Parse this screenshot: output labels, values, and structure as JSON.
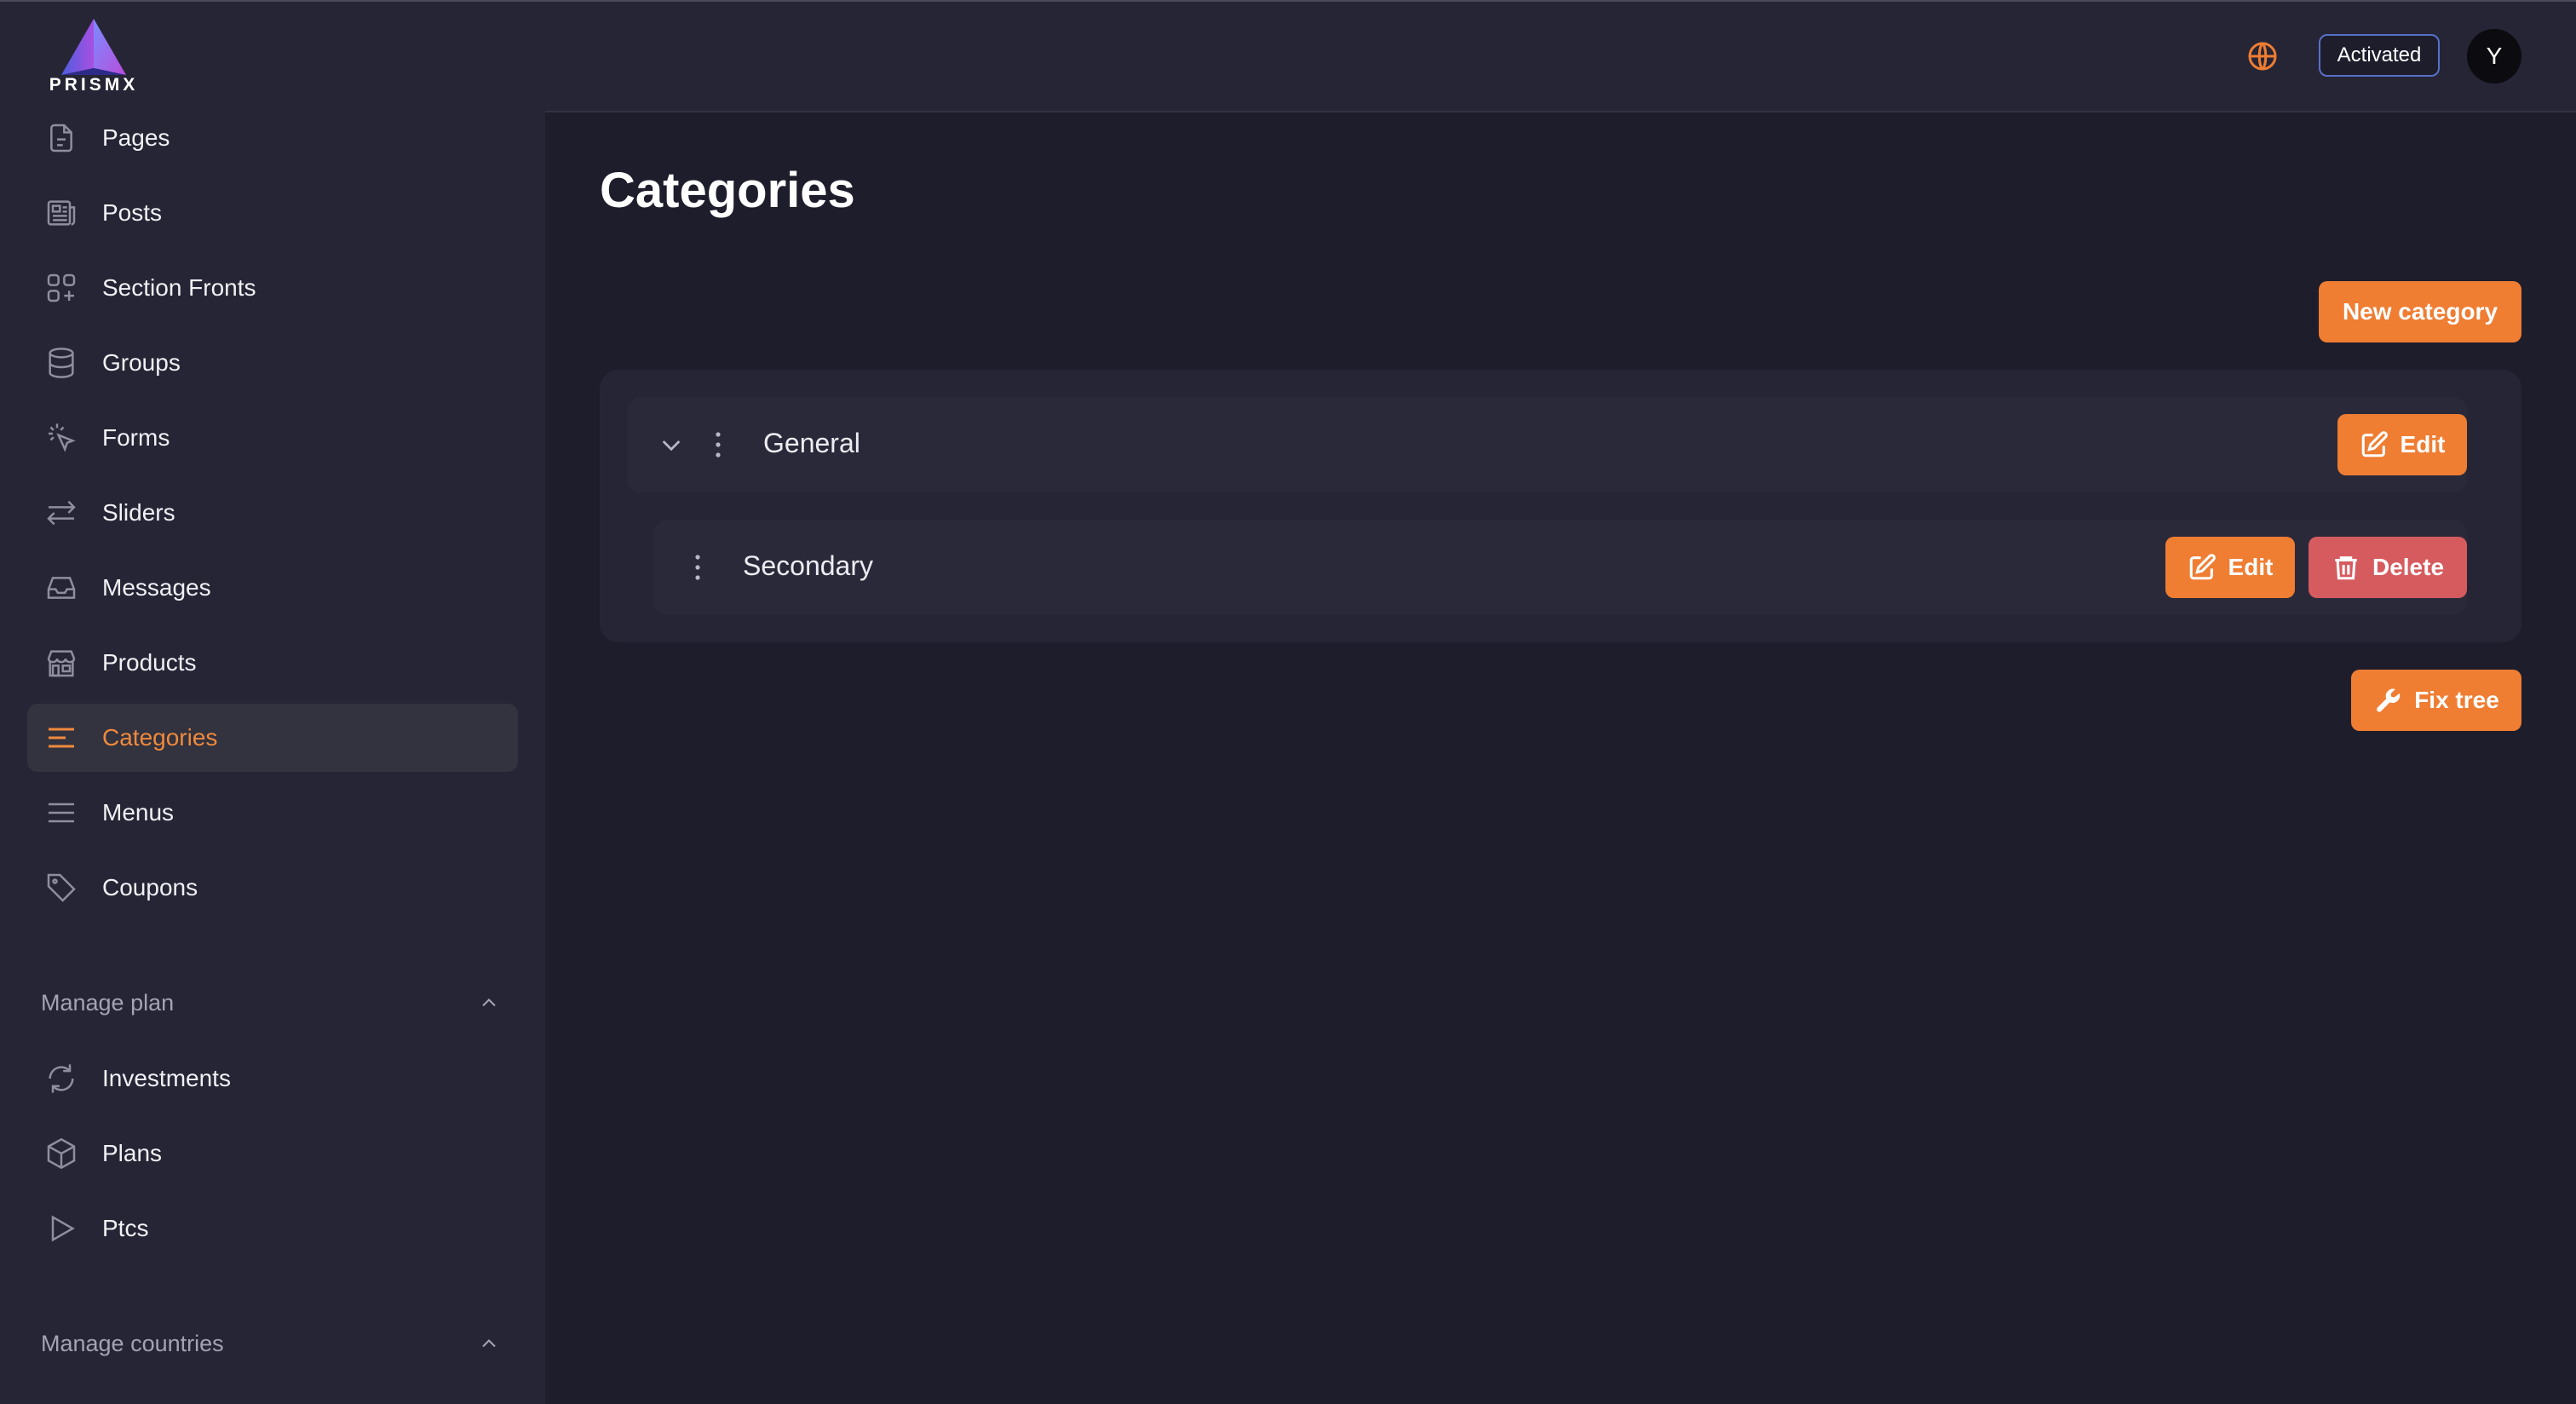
{
  "brand": {
    "name": "PRISMX"
  },
  "sidebar": {
    "items": [
      {
        "label": "Pages",
        "icon": "document-icon"
      },
      {
        "label": "Posts",
        "icon": "newspaper-icon"
      },
      {
        "label": "Section Fronts",
        "icon": "squares-plus-icon"
      },
      {
        "label": "Groups",
        "icon": "database-icon"
      },
      {
        "label": "Forms",
        "icon": "cursor-click-icon"
      },
      {
        "label": "Sliders",
        "icon": "arrows-right-left-icon"
      },
      {
        "label": "Messages",
        "icon": "inbox-icon"
      },
      {
        "label": "Products",
        "icon": "storefront-icon"
      },
      {
        "label": "Categories",
        "icon": "bars-left-icon",
        "active": true
      },
      {
        "label": "Menus",
        "icon": "bars-icon"
      },
      {
        "label": "Coupons",
        "icon": "tag-icon"
      }
    ],
    "manage_plan": {
      "title": "Manage plan",
      "items": [
        {
          "label": "Investments",
          "icon": "refresh-icon"
        },
        {
          "label": "Plans",
          "icon": "cube-icon"
        },
        {
          "label": "Ptcs",
          "icon": "play-icon"
        }
      ]
    },
    "manage_countries": {
      "title": "Manage countries"
    }
  },
  "header": {
    "status_badge": "Activated",
    "avatar_initial": "Y",
    "globe_icon": "globe-icon"
  },
  "main": {
    "title": "Categories",
    "new_category_label": "New category",
    "tree": [
      {
        "name": "General",
        "edit_label": "Edit",
        "expanded": true
      },
      {
        "name": "Secondary",
        "edit_label": "Edit",
        "delete_label": "Delete"
      }
    ],
    "fix_tree_label": "Fix tree"
  },
  "colors": {
    "accent": "#ef7d32",
    "danger": "#d65b5f",
    "background": "#1e1d2c",
    "sidebar": "#262535",
    "badge_border": "#5870c8"
  }
}
